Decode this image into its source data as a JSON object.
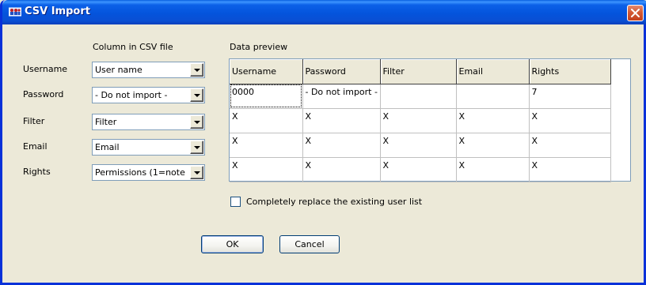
{
  "window": {
    "title": "CSV Import",
    "colors": {
      "titlebar": "#0454dc",
      "frame": "#0831d9",
      "face": "#ece9d8",
      "close": "#d35a35"
    }
  },
  "mapping": {
    "column_header": "Column in CSV file",
    "rows": [
      {
        "label": "Username",
        "value": "User name"
      },
      {
        "label": "Password",
        "value": "- Do not import -"
      },
      {
        "label": "Filter",
        "value": "Filter"
      },
      {
        "label": "Email",
        "value": "Email"
      },
      {
        "label": "Rights",
        "value": "Permissions (1=note"
      }
    ]
  },
  "preview": {
    "header": "Data preview",
    "columns": [
      "Username",
      "Password",
      "Filter",
      "Email",
      "Rights"
    ],
    "rows": [
      [
        "0000",
        "- Do not import -",
        "",
        "",
        "7"
      ],
      [
        "X",
        "X",
        "X",
        "X",
        "X"
      ],
      [
        "X",
        "X",
        "X",
        "X",
        "X"
      ],
      [
        "X",
        "X",
        "X",
        "X",
        "X"
      ]
    ]
  },
  "replace_option": {
    "label": "Completely replace the existing user list",
    "checked": false
  },
  "buttons": {
    "ok": "OK",
    "cancel": "Cancel"
  },
  "icons": {
    "app": "user-group-icon",
    "close": "close-icon",
    "dropdown": "chevron-down-icon"
  }
}
